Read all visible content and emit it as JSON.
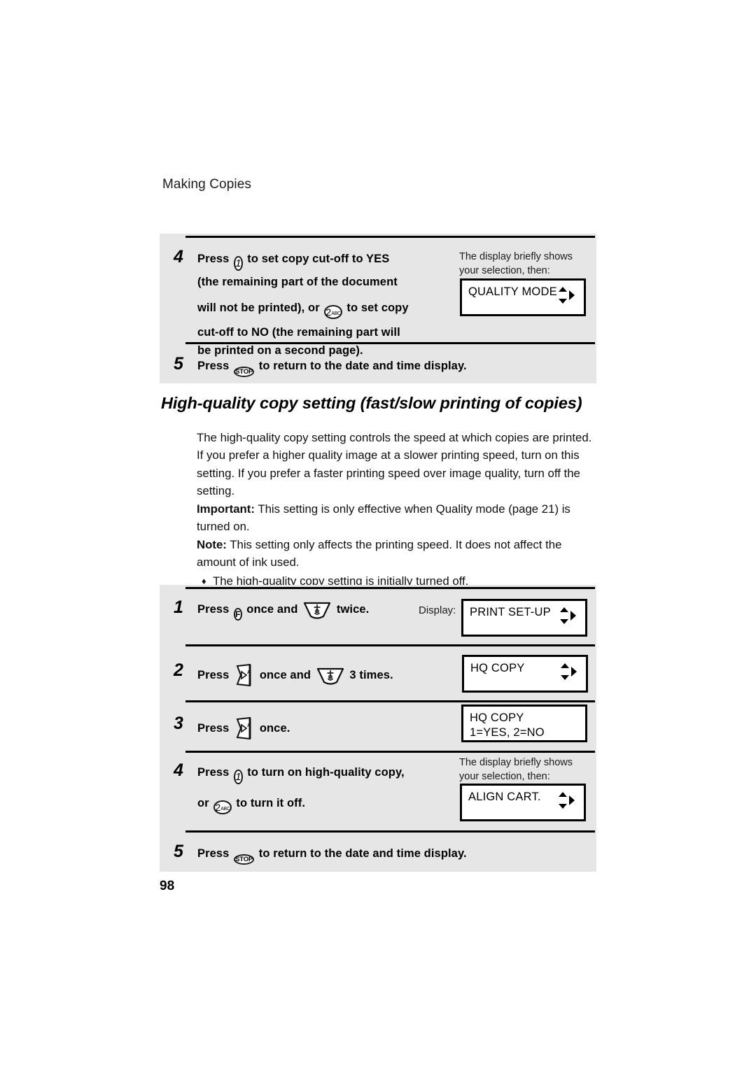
{
  "page": {
    "running_head": "Making Copies",
    "folio": "98",
    "background": "#ffffff",
    "block_fill": "#e6e6e6",
    "rule_color": "#000000"
  },
  "top_procedure": {
    "steps": [
      {
        "number": "4",
        "lines": [
          {
            "segments": [
              {
                "type": "text",
                "text": "Press "
              },
              {
                "type": "key",
                "key": "key-1"
              },
              {
                "type": "text",
                "text": " to set copy cut-off to YES"
              }
            ]
          },
          {
            "segments": [
              {
                "type": "text",
                "text": "(the remaining part of the document"
              }
            ]
          },
          {
            "gap": true,
            "segments": [
              {
                "type": "text",
                "text": "will not be printed), or "
              },
              {
                "type": "key",
                "key": "key-2abc"
              },
              {
                "type": "text",
                "text": " to set copy"
              }
            ]
          },
          {
            "segments": [
              {
                "type": "text",
                "text": "cut-off to NO (the remaining part will"
              }
            ]
          },
          {
            "segments": [
              {
                "type": "text",
                "text": "be printed on a second page)."
              }
            ]
          }
        ],
        "side_note": "The display briefly shows\nyour selection, then:",
        "display": {
          "lines": "QUALITY MODE",
          "arrows": true
        }
      },
      {
        "number": "5",
        "lines": [
          {
            "segments": [
              {
                "type": "text",
                "text": "Press "
              },
              {
                "type": "key",
                "key": "key-stop"
              },
              {
                "type": "text",
                "text": " to return to the date and time display."
              }
            ]
          }
        ]
      }
    ]
  },
  "section": {
    "heading": "High-quality copy setting (fast/slow printing of copies)",
    "paragraphs": [
      {
        "text": "The high-quality copy setting controls the speed at which copies are printed. If you prefer a higher quality image at a slower printing speed, turn on this setting. If you prefer a faster printing speed over image quality, turn off the setting."
      },
      {
        "lead": "Important:",
        "text": " This setting is only effective when Quality mode (page 21) is turned on."
      },
      {
        "lead": "Note:",
        "text": " This setting only affects the printing speed. It does not affect the amount of ink used."
      }
    ],
    "bullet": {
      "marker": "♦",
      "text": "The high-quality copy setting is initially turned off."
    }
  },
  "bottom_procedure": {
    "display_label": "Display:",
    "steps": [
      {
        "number": "1",
        "lines": [
          {
            "segments": [
              {
                "type": "text",
                "text": "Press "
              },
              {
                "type": "key",
                "key": "key-f"
              },
              {
                "type": "text",
                "text": " once and "
              },
              {
                "type": "key",
                "key": "key-down-funnel"
              },
              {
                "type": "text",
                "text": " twice."
              }
            ]
          }
        ],
        "display": {
          "lines": "PRINT SET-UP",
          "arrows": true
        }
      },
      {
        "number": "2",
        "lines": [
          {
            "segments": [
              {
                "type": "text",
                "text": "Press "
              },
              {
                "type": "key",
                "key": "key-da-arrow"
              },
              {
                "type": "text",
                "text": " once and "
              },
              {
                "type": "key",
                "key": "key-down-funnel"
              },
              {
                "type": "text",
                "text": " 3 times."
              }
            ]
          }
        ],
        "display": {
          "lines": "HQ COPY",
          "arrows": true
        }
      },
      {
        "number": "3",
        "lines": [
          {
            "segments": [
              {
                "type": "text",
                "text": "Press "
              },
              {
                "type": "key",
                "key": "key-da-arrow"
              },
              {
                "type": "text",
                "text": " once."
              }
            ]
          }
        ],
        "display": {
          "lines": "HQ COPY\n1=YES, 2=NO",
          "arrows": false
        }
      },
      {
        "number": "4",
        "lines": [
          {
            "segments": [
              {
                "type": "text",
                "text": "Press "
              },
              {
                "type": "key",
                "key": "key-1"
              },
              {
                "type": "text",
                "text": " to turn on high-quality copy,"
              }
            ]
          },
          {
            "gap": true,
            "segments": [
              {
                "type": "text",
                "text": "or "
              },
              {
                "type": "key",
                "key": "key-2abc"
              },
              {
                "type": "text",
                "text": " to turn it off."
              }
            ]
          }
        ],
        "side_note": "The display briefly shows\nyour selection, then:",
        "display": {
          "lines": "ALIGN CART.",
          "arrows": true
        }
      },
      {
        "number": "5",
        "lines": [
          {
            "segments": [
              {
                "type": "text",
                "text": "Press "
              },
              {
                "type": "key",
                "key": "key-stop"
              },
              {
                "type": "text",
                "text": " to return to the date and time display."
              }
            ]
          }
        ]
      }
    ]
  },
  "keys": {
    "key-1": {
      "label": "1",
      "shape": "circle"
    },
    "key-2abc": {
      "label": "2",
      "sub": "ABC",
      "shape": "circle"
    },
    "key-stop": {
      "label": "STOP",
      "shape": "circle"
    },
    "key-f": {
      "label": "F",
      "shape": "circle"
    },
    "key-down-funnel": {
      "label": "",
      "shape": "down-funnel"
    },
    "key-da-arrow": {
      "label": "D/A",
      "shape": "right-arrow-flag"
    }
  }
}
